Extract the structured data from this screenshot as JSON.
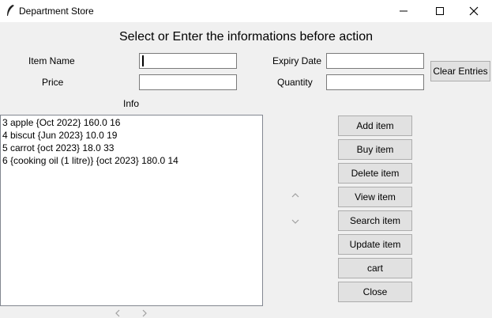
{
  "window": {
    "title": "Department Store"
  },
  "heading": "Select or Enter the informations before action",
  "form": {
    "item_name_label": "Item Name",
    "price_label": "Price",
    "expiry_label": "Expiry Date",
    "quantity_label": "Quantity",
    "item_name_value": "",
    "price_value": "",
    "expiry_value": "",
    "quantity_value": "",
    "clear_label": "Clear Entries"
  },
  "info_label": "Info",
  "list": [
    "3 apple {Oct 2022} 160.0 16",
    "4 biscut {Jun 2023} 10.0 19",
    "5 carrot {oct 2023} 18.0 33",
    "6 {cooking oil (1 litre)} {oct 2023} 180.0 14"
  ],
  "buttons": {
    "add": "Add item",
    "buy": "Buy item",
    "delete": "Delete item",
    "view": "View item",
    "search": "Search item",
    "update": "Update item",
    "cart": "cart",
    "close": "Close"
  },
  "icons": {
    "app": "feather-icon",
    "minimize": "minimize-icon",
    "maximize": "maximize-icon",
    "close": "close-icon",
    "scroll_up": "chevron-up-icon",
    "scroll_down": "chevron-down-icon",
    "scroll_left": "chevron-left-icon",
    "scroll_right": "chevron-right-icon"
  }
}
